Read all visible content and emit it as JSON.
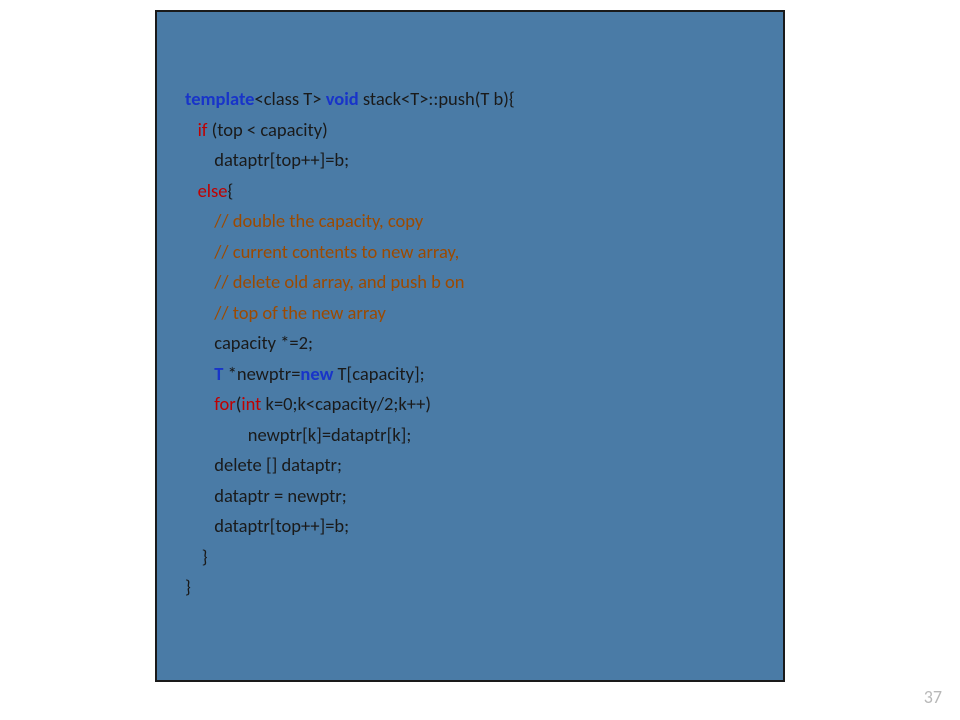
{
  "page_number": "37",
  "code": {
    "l1_kw1": "template",
    "l1_t1": "<class T> ",
    "l1_kw2": "void",
    "l1_t2": " stack<T>::push(T b){",
    "l2_kw": "if",
    "l2_t": " (top < capacity)",
    "l3_t": "       dataptr[top++]=b;",
    "l4_kw": "else",
    "l4_t": "{",
    "l5_c": "// double the capacity, copy",
    "l6_c": "// current contents to new array,",
    "l7_c": "// delete old array, and push b on",
    "l8_c": "// top of the new array",
    "l9_t": "       capacity *=2;",
    "l10_kw1": "T",
    "l10_t1": " *newptr=",
    "l10_kw2": "new",
    "l10_t2": " T[capacity];",
    "l11_kw1": "for",
    "l11_t1": "(",
    "l11_kw2": "int",
    "l11_t2": " k=0;k<capacity/2;k++)",
    "l12_t": "               newptr[k]=dataptr[k];",
    "l13_t": "       delete [] dataptr;",
    "l14_t": "       dataptr = newptr;",
    "l15_t": "       dataptr[top++]=b;",
    "l16_t": "    }",
    "l17_t": "}"
  }
}
